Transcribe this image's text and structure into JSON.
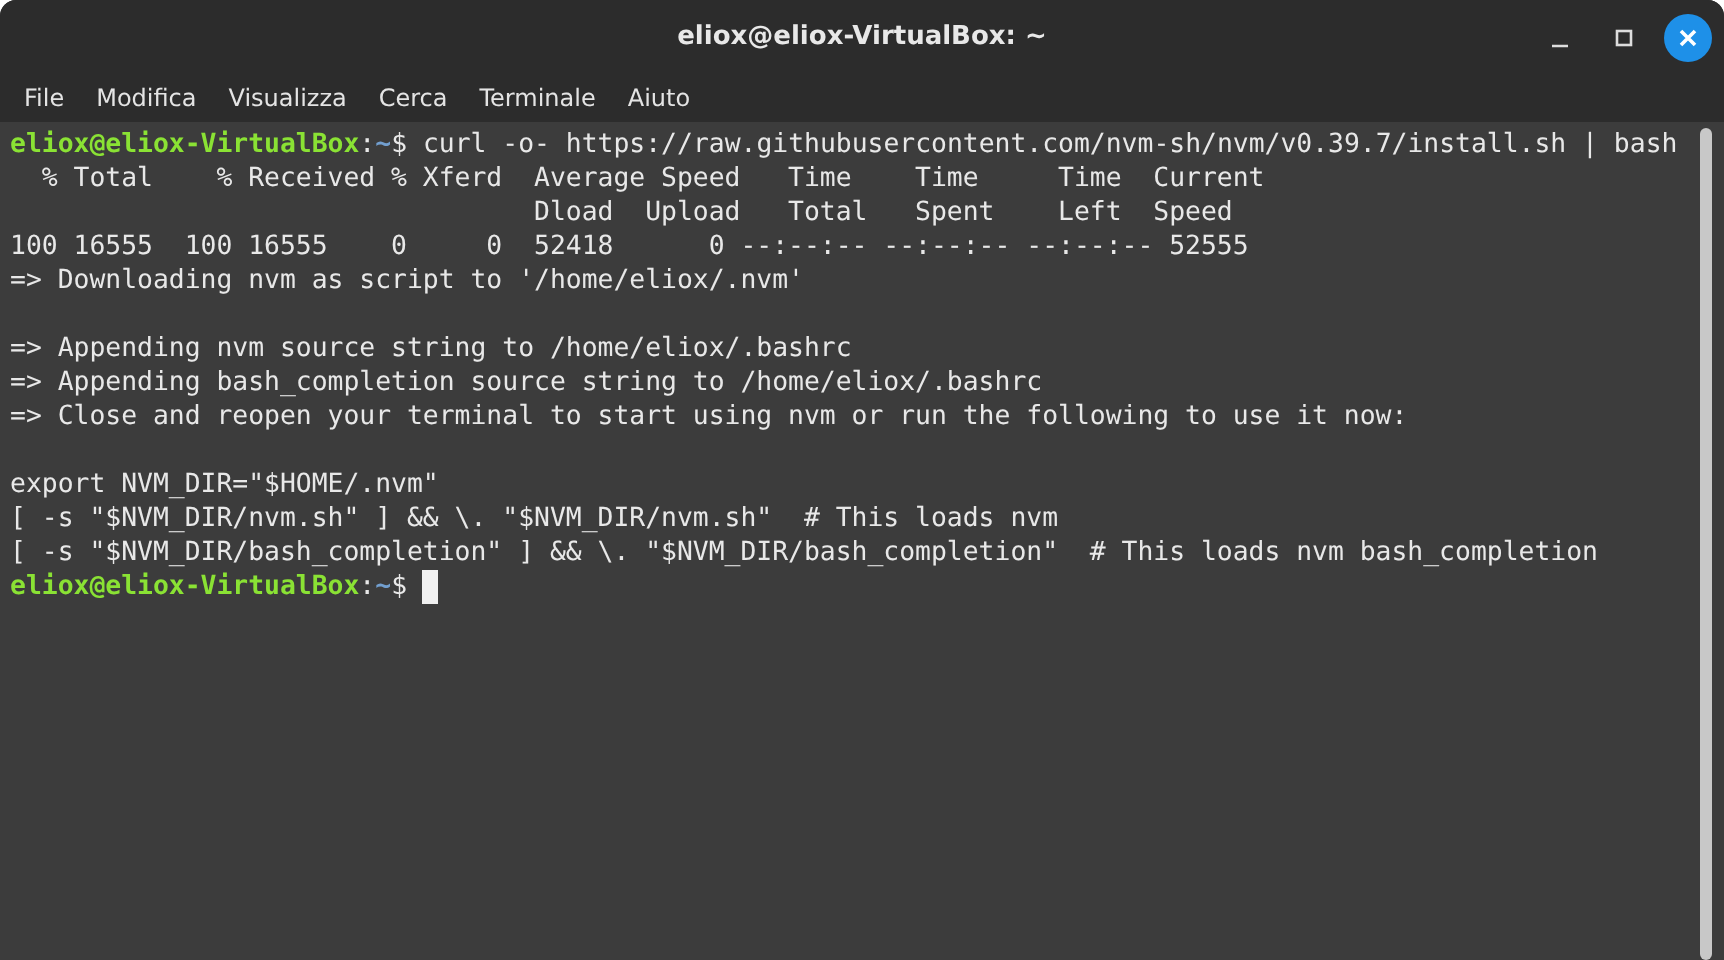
{
  "window": {
    "title": "eliox@eliox-VirtualBox: ~"
  },
  "menu": [
    "File",
    "Modifica",
    "Visualizza",
    "Cerca",
    "Terminale",
    "Aiuto"
  ],
  "terminal": {
    "lines": [
      {
        "kind": "prompt",
        "user_host": "eliox@eliox-VirtualBox",
        "separator": ":",
        "path": "~",
        "symbol": "$",
        "command": "curl -o- https://raw.githubusercontent.com/nvm-sh/nvm/v0.39.7/install.sh | bash",
        "cursor": false
      },
      {
        "kind": "output",
        "text": "  % Total    % Received % Xferd  Average Speed   Time    Time     Time  Current"
      },
      {
        "kind": "output",
        "text": "                                 Dload  Upload   Total   Spent    Left  Speed"
      },
      {
        "kind": "output",
        "text": "100 16555  100 16555    0     0  52418      0 --:--:-- --:--:-- --:--:-- 52555"
      },
      {
        "kind": "output",
        "text": "=> Downloading nvm as script to '/home/eliox/.nvm'"
      },
      {
        "kind": "blank"
      },
      {
        "kind": "output",
        "text": "=> Appending nvm source string to /home/eliox/.bashrc"
      },
      {
        "kind": "output",
        "text": "=> Appending bash_completion source string to /home/eliox/.bashrc"
      },
      {
        "kind": "output",
        "text": "=> Close and reopen your terminal to start using nvm or run the following to use it now:"
      },
      {
        "kind": "blank"
      },
      {
        "kind": "output",
        "text": "export NVM_DIR=\"$HOME/.nvm\""
      },
      {
        "kind": "output",
        "text": "[ -s \"$NVM_DIR/nvm.sh\" ] && \\. \"$NVM_DIR/nvm.sh\"  # This loads nvm"
      },
      {
        "kind": "output",
        "text": "[ -s \"$NVM_DIR/bash_completion\" ] && \\. \"$NVM_DIR/bash_completion\"  # This loads nvm bash_completion"
      },
      {
        "kind": "prompt",
        "user_host": "eliox@eliox-VirtualBox",
        "separator": ":",
        "path": "~",
        "symbol": "$",
        "cursor": true
      }
    ]
  }
}
